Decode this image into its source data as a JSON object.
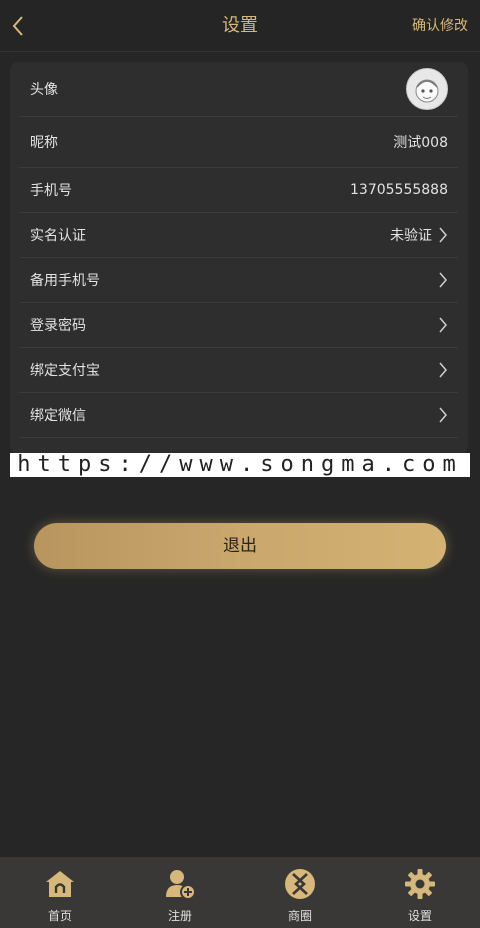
{
  "header": {
    "title": "设置",
    "confirm_label": "确认修改",
    "back_icon": "chevron-left-icon"
  },
  "settings": {
    "avatar_label": "头像",
    "nickname_label": "昵称",
    "nickname_value": "测试008",
    "phone_label": "手机号",
    "phone_value": "13705555888",
    "realname_label": "实名认证",
    "realname_value": "未验证",
    "backup_phone_label": "备用手机号",
    "password_label": "登录密码",
    "alipay_label": "绑定支付宝",
    "wechat_label": "绑定微信"
  },
  "watermark": "https://www.songma.com",
  "logout_label": "退出",
  "tabbar": {
    "home": "首页",
    "register": "注册",
    "mall": "商圈",
    "settings": "设置"
  },
  "colors": {
    "accent": "#d6b77c",
    "background": "#262626",
    "card": "#2e2e2e",
    "tabbar": "#3a3836"
  }
}
